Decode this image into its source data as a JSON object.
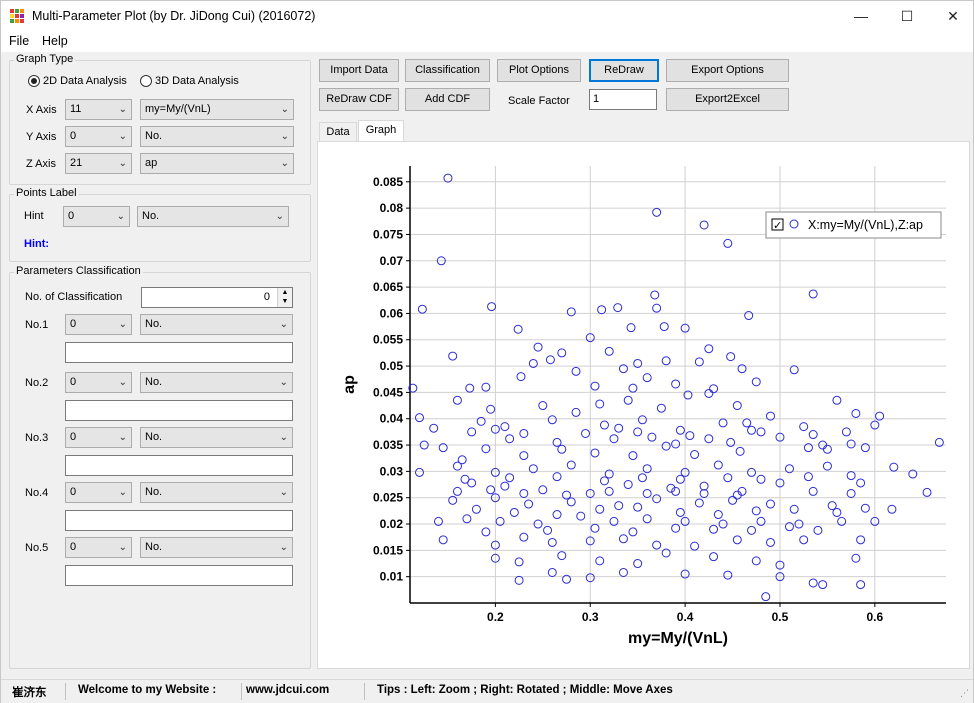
{
  "window": {
    "title": "Multi-Parameter Plot (by Dr. JiDong Cui) (2016072)"
  },
  "menu": {
    "file": "File",
    "help": "Help"
  },
  "graph_type": {
    "title": "Graph Type",
    "option_2d": "2D Data Analysis",
    "option_3d": "3D Data Analysis",
    "x_axis_label": "X Axis",
    "x_axis_index": "11",
    "x_axis_name": "my=My/(VnL)",
    "y_axis_label": "Y Axis",
    "y_axis_index": "0",
    "y_axis_name": "No.",
    "z_axis_label": "Z Axis",
    "z_axis_index": "21",
    "z_axis_name": "ap"
  },
  "points_label": {
    "title": "Points Label",
    "hint_label": "Hint",
    "hint_index": "0",
    "hint_name": "No.",
    "hint_text": "Hint:"
  },
  "parameters": {
    "title": "Parameters Classification",
    "count_label": "No. of Classification",
    "count_value": "0",
    "rows": [
      {
        "label": "No.1",
        "index": "0",
        "name": "No.",
        "text": ""
      },
      {
        "label": "No.2",
        "index": "0",
        "name": "No.",
        "text": ""
      },
      {
        "label": "No.3",
        "index": "0",
        "name": "No.",
        "text": ""
      },
      {
        "label": "No.4",
        "index": "0",
        "name": "No.",
        "text": ""
      },
      {
        "label": "No.5",
        "index": "0",
        "name": "No.",
        "text": ""
      }
    ]
  },
  "toolbar": {
    "import_data": "Import Data",
    "classification": "Classification",
    "plot_options": "Plot Options",
    "redraw": "ReDraw",
    "export_options": "Export Options",
    "redraw_cdf": "ReDraw CDF",
    "add_cdf": "Add CDF",
    "scale_factor_label": "Scale Factor",
    "scale_factor_value": "1",
    "export2excel": "Export2Excel"
  },
  "tabs": {
    "data": "Data",
    "graph": "Graph"
  },
  "status": {
    "author": "崔济东",
    "welcome": "Welcome to my Website :",
    "website": "www.jdcui.com",
    "tips": "Tips : Left: Zoom ; Right: Rotated ; Middle: Move Axes"
  },
  "colors": {
    "marker": "#2b2bd6",
    "focus": "#0078d7",
    "hint": "#0000ff"
  },
  "chart_data": {
    "type": "scatter",
    "xlabel": "my=My/(VnL)",
    "ylabel": "ap",
    "xlim": [
      0.11,
      0.675
    ],
    "ylim": [
      0.005,
      0.088
    ],
    "xticks": [
      "0.2",
      "0.3",
      "0.4",
      "0.5",
      "0.6"
    ],
    "yticks": [
      "0.01",
      "0.015",
      "0.02",
      "0.025",
      "0.03",
      "0.035",
      "0.04",
      "0.045",
      "0.05",
      "0.055",
      "0.06",
      "0.065",
      "0.07",
      "0.075",
      "0.08",
      "0.085"
    ],
    "grid": true,
    "legend": {
      "position": "top-right",
      "checked": true,
      "label": "X:my=My/(VnL),Z:ap"
    },
    "series": [
      {
        "name": "X:my=My/(VnL),Z:ap",
        "points": [
          [
            0.15,
            0.0857
          ],
          [
            0.37,
            0.0792
          ],
          [
            0.42,
            0.0768
          ],
          [
            0.445,
            0.0733
          ],
          [
            0.143,
            0.07
          ],
          [
            0.535,
            0.0637
          ],
          [
            0.368,
            0.0635
          ],
          [
            0.123,
            0.0608
          ],
          [
            0.196,
            0.0613
          ],
          [
            0.28,
            0.0603
          ],
          [
            0.312,
            0.0607
          ],
          [
            0.329,
            0.0611
          ],
          [
            0.37,
            0.061
          ],
          [
            0.467,
            0.0596
          ],
          [
            0.155,
            0.0519
          ],
          [
            0.224,
            0.057
          ],
          [
            0.3,
            0.0554
          ],
          [
            0.343,
            0.0573
          ],
          [
            0.378,
            0.0575
          ],
          [
            0.4,
            0.0572
          ],
          [
            0.245,
            0.0536
          ],
          [
            0.258,
            0.0512
          ],
          [
            0.27,
            0.0525
          ],
          [
            0.32,
            0.0528
          ],
          [
            0.425,
            0.0533
          ],
          [
            0.448,
            0.0518
          ],
          [
            0.515,
            0.0493
          ],
          [
            0.113,
            0.0458
          ],
          [
            0.173,
            0.0458
          ],
          [
            0.227,
            0.048
          ],
          [
            0.335,
            0.0495
          ],
          [
            0.36,
            0.0478
          ],
          [
            0.39,
            0.0466
          ],
          [
            0.43,
            0.0457
          ],
          [
            0.475,
            0.047
          ],
          [
            0.16,
            0.0435
          ],
          [
            0.195,
            0.0418
          ],
          [
            0.25,
            0.0425
          ],
          [
            0.285,
            0.0412
          ],
          [
            0.31,
            0.0428
          ],
          [
            0.34,
            0.0435
          ],
          [
            0.375,
            0.042
          ],
          [
            0.403,
            0.0445
          ],
          [
            0.455,
            0.0425
          ],
          [
            0.49,
            0.0405
          ],
          [
            0.56,
            0.0435
          ],
          [
            0.58,
            0.041
          ],
          [
            0.12,
            0.0402
          ],
          [
            0.175,
            0.0375
          ],
          [
            0.21,
            0.0385
          ],
          [
            0.26,
            0.0398
          ],
          [
            0.295,
            0.0372
          ],
          [
            0.33,
            0.0382
          ],
          [
            0.365,
            0.0365
          ],
          [
            0.395,
            0.0378
          ],
          [
            0.44,
            0.0392
          ],
          [
            0.47,
            0.0378
          ],
          [
            0.525,
            0.0385
          ],
          [
            0.6,
            0.0388
          ],
          [
            0.125,
            0.035
          ],
          [
            0.145,
            0.0345
          ],
          [
            0.19,
            0.0343
          ],
          [
            0.23,
            0.033
          ],
          [
            0.27,
            0.0342
          ],
          [
            0.305,
            0.0335
          ],
          [
            0.345,
            0.033
          ],
          [
            0.38,
            0.0348
          ],
          [
            0.41,
            0.0332
          ],
          [
            0.458,
            0.0338
          ],
          [
            0.5,
            0.0365
          ],
          [
            0.545,
            0.035
          ],
          [
            0.57,
            0.0375
          ],
          [
            0.668,
            0.0355
          ],
          [
            0.16,
            0.031
          ],
          [
            0.2,
            0.0298
          ],
          [
            0.24,
            0.0305
          ],
          [
            0.28,
            0.0312
          ],
          [
            0.32,
            0.0295
          ],
          [
            0.36,
            0.0305
          ],
          [
            0.4,
            0.0298
          ],
          [
            0.435,
            0.0312
          ],
          [
            0.47,
            0.0298
          ],
          [
            0.51,
            0.0305
          ],
          [
            0.55,
            0.031
          ],
          [
            0.62,
            0.0308
          ],
          [
            0.64,
            0.0295
          ],
          [
            0.12,
            0.0298
          ],
          [
            0.175,
            0.0278
          ],
          [
            0.21,
            0.0272
          ],
          [
            0.25,
            0.0265
          ],
          [
            0.3,
            0.0258
          ],
          [
            0.34,
            0.0275
          ],
          [
            0.385,
            0.0268
          ],
          [
            0.42,
            0.0272
          ],
          [
            0.46,
            0.0262
          ],
          [
            0.5,
            0.0278
          ],
          [
            0.585,
            0.0278
          ],
          [
            0.655,
            0.026
          ],
          [
            0.155,
            0.0245
          ],
          [
            0.2,
            0.025
          ],
          [
            0.235,
            0.0238
          ],
          [
            0.28,
            0.0242
          ],
          [
            0.33,
            0.0235
          ],
          [
            0.37,
            0.0248
          ],
          [
            0.415,
            0.024
          ],
          [
            0.45,
            0.0245
          ],
          [
            0.49,
            0.0238
          ],
          [
            0.555,
            0.0235
          ],
          [
            0.59,
            0.023
          ],
          [
            0.618,
            0.0228
          ],
          [
            0.14,
            0.0205
          ],
          [
            0.17,
            0.021
          ],
          [
            0.205,
            0.0205
          ],
          [
            0.245,
            0.02
          ],
          [
            0.29,
            0.0215
          ],
          [
            0.325,
            0.0205
          ],
          [
            0.36,
            0.021
          ],
          [
            0.4,
            0.0205
          ],
          [
            0.44,
            0.02
          ],
          [
            0.48,
            0.0205
          ],
          [
            0.52,
            0.02
          ],
          [
            0.565,
            0.0205
          ],
          [
            0.145,
            0.017
          ],
          [
            0.2,
            0.016
          ],
          [
            0.23,
            0.0175
          ],
          [
            0.26,
            0.0165
          ],
          [
            0.3,
            0.0168
          ],
          [
            0.335,
            0.0172
          ],
          [
            0.37,
            0.016
          ],
          [
            0.41,
            0.0158
          ],
          [
            0.455,
            0.017
          ],
          [
            0.49,
            0.0165
          ],
          [
            0.525,
            0.017
          ],
          [
            0.585,
            0.017
          ],
          [
            0.2,
            0.0135
          ],
          [
            0.225,
            0.0128
          ],
          [
            0.27,
            0.014
          ],
          [
            0.31,
            0.013
          ],
          [
            0.35,
            0.0125
          ],
          [
            0.38,
            0.0145
          ],
          [
            0.43,
            0.0138
          ],
          [
            0.475,
            0.013
          ],
          [
            0.5,
            0.0122
          ],
          [
            0.58,
            0.0135
          ],
          [
            0.225,
            0.0093
          ],
          [
            0.26,
            0.0108
          ],
          [
            0.275,
            0.0095
          ],
          [
            0.3,
            0.0098
          ],
          [
            0.335,
            0.0108
          ],
          [
            0.4,
            0.0105
          ],
          [
            0.445,
            0.0103
          ],
          [
            0.5,
            0.01
          ],
          [
            0.535,
            0.0088
          ],
          [
            0.545,
            0.0085
          ],
          [
            0.585,
            0.0085
          ],
          [
            0.485,
            0.0062
          ],
          [
            0.135,
            0.0382
          ],
          [
            0.165,
            0.0322
          ],
          [
            0.185,
            0.0395
          ],
          [
            0.215,
            0.0362
          ],
          [
            0.265,
            0.0355
          ],
          [
            0.315,
            0.0388
          ],
          [
            0.355,
            0.0398
          ],
          [
            0.39,
            0.0352
          ],
          [
            0.425,
            0.0362
          ],
          [
            0.465,
            0.0392
          ],
          [
            0.53,
            0.0345
          ],
          [
            0.575,
            0.0352
          ],
          [
            0.59,
            0.0345
          ],
          [
            0.19,
            0.0185
          ],
          [
            0.255,
            0.0188
          ],
          [
            0.305,
            0.0192
          ],
          [
            0.345,
            0.0185
          ],
          [
            0.39,
            0.0192
          ],
          [
            0.43,
            0.019
          ],
          [
            0.47,
            0.0188
          ],
          [
            0.51,
            0.0195
          ],
          [
            0.54,
            0.0188
          ],
          [
            0.6,
            0.0205
          ],
          [
            0.18,
            0.0228
          ],
          [
            0.22,
            0.0222
          ],
          [
            0.265,
            0.0218
          ],
          [
            0.31,
            0.0228
          ],
          [
            0.35,
            0.0232
          ],
          [
            0.395,
            0.0222
          ],
          [
            0.435,
            0.0218
          ],
          [
            0.475,
            0.0225
          ],
          [
            0.515,
            0.0228
          ],
          [
            0.56,
            0.0222
          ],
          [
            0.168,
            0.0285
          ],
          [
            0.215,
            0.0288
          ],
          [
            0.265,
            0.029
          ],
          [
            0.315,
            0.0282
          ],
          [
            0.355,
            0.0288
          ],
          [
            0.395,
            0.0285
          ],
          [
            0.445,
            0.0288
          ],
          [
            0.48,
            0.0285
          ],
          [
            0.53,
            0.029
          ],
          [
            0.575,
            0.0292
          ],
          [
            0.19,
            0.046
          ],
          [
            0.24,
            0.0505
          ],
          [
            0.285,
            0.049
          ],
          [
            0.35,
            0.0505
          ],
          [
            0.38,
            0.051
          ],
          [
            0.415,
            0.0508
          ],
          [
            0.46,
            0.0495
          ],
          [
            0.305,
            0.0462
          ],
          [
            0.345,
            0.0458
          ],
          [
            0.425,
            0.0448
          ],
          [
            0.2,
            0.038
          ],
          [
            0.23,
            0.0372
          ],
          [
            0.325,
            0.0362
          ],
          [
            0.35,
            0.0375
          ],
          [
            0.405,
            0.0368
          ],
          [
            0.448,
            0.0355
          ],
          [
            0.48,
            0.0375
          ],
          [
            0.535,
            0.037
          ],
          [
            0.55,
            0.0342
          ],
          [
            0.605,
            0.0405
          ],
          [
            0.16,
            0.0262
          ],
          [
            0.195,
            0.0265
          ],
          [
            0.23,
            0.0258
          ],
          [
            0.275,
            0.0255
          ],
          [
            0.32,
            0.0262
          ],
          [
            0.36,
            0.0258
          ],
          [
            0.39,
            0.0262
          ],
          [
            0.42,
            0.0258
          ],
          [
            0.455,
            0.0255
          ],
          [
            0.535,
            0.0262
          ],
          [
            0.575,
            0.0258
          ]
        ]
      }
    ]
  }
}
